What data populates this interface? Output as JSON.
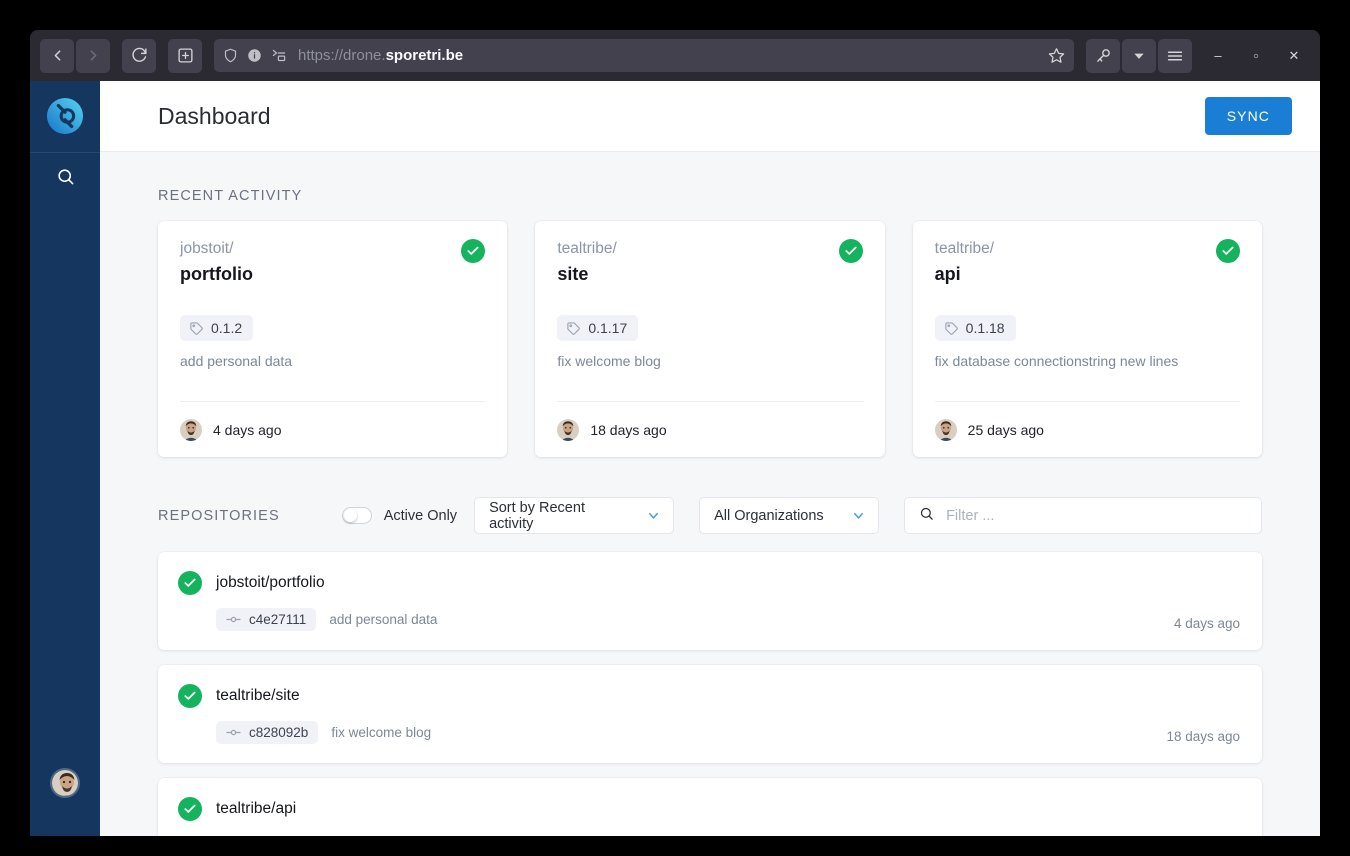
{
  "browser": {
    "nav": {
      "back": "back-arrow",
      "forward": "forward-arrow",
      "reload": "reload-icon",
      "newtab": "new-tab-icon"
    },
    "url": {
      "scheme_path": "https://drone.",
      "host": "sporetri.be",
      "shield_icon": "shield-icon",
      "info_icon": "info-icon",
      "reader_icon": "reader-mode-icon",
      "bookmark_icon": "star-icon"
    },
    "actions": {
      "key_icon": "key-icon",
      "dropdown_icon": "chevron-down-icon",
      "menu_icon": "hamburger-menu-icon",
      "minimize": "–",
      "maximize": "▫",
      "close": "✕"
    }
  },
  "sidebar": {
    "logo": "drone-logo",
    "search_icon": "search-icon",
    "avatar": "user-avatar"
  },
  "header": {
    "title": "Dashboard",
    "sync_label": "SYNC"
  },
  "recent_activity": {
    "label": "RECENT ACTIVITY",
    "cards": [
      {
        "org": "jobstoit/",
        "repo": "portfolio",
        "tag": "0.1.2",
        "message": "add personal data",
        "time": "4 days ago",
        "status": "success"
      },
      {
        "org": "tealtribe/",
        "repo": "site",
        "tag": "0.1.17",
        "message": "fix welcome blog",
        "time": "18 days ago",
        "status": "success"
      },
      {
        "org": "tealtribe/",
        "repo": "api",
        "tag": "0.1.18",
        "message": "fix database connectionstring new lines",
        "time": "25 days ago",
        "status": "success"
      }
    ]
  },
  "repositories": {
    "label": "REPOSITORIES",
    "active_only_label": "Active Only",
    "active_only_value": false,
    "sort_value": "Sort by Recent activity",
    "org_value": "All Organizations",
    "filter_placeholder": "Filter ...",
    "filter_value": "",
    "items": [
      {
        "name": "jobstoit/portfolio",
        "commit": "c4e27111",
        "message": "add personal data",
        "time": "4 days ago",
        "status": "success"
      },
      {
        "name": "tealtribe/site",
        "commit": "c828092b",
        "message": "fix welcome blog",
        "time": "18 days ago",
        "status": "success"
      },
      {
        "name": "tealtribe/api",
        "commit": "",
        "message": "",
        "time": "",
        "status": "success"
      }
    ]
  },
  "colors": {
    "accent": "#1a7fd4",
    "success": "#15b35e",
    "sidebar": "#14365f",
    "page_bg": "#f6f7f9"
  }
}
